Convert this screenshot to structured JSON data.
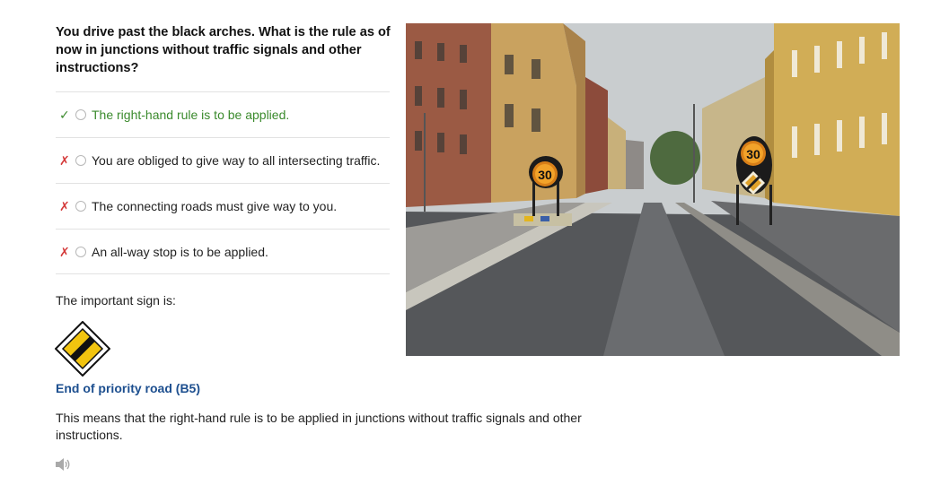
{
  "question": {
    "text": "You drive past the black arches. What is the rule as of now in junctions without traffic signals and other instructions?"
  },
  "answers": [
    {
      "mark": "✓",
      "label": "The right-hand rule is to be applied.",
      "status": "correct"
    },
    {
      "mark": "✗",
      "label": "You are obliged to give way to all intersecting traffic.",
      "status": "wrong"
    },
    {
      "mark": "✗",
      "label": "The connecting roads must give way to you.",
      "status": "wrong"
    },
    {
      "mark": "✗",
      "label": "An all-way stop is to be applied.",
      "status": "wrong"
    }
  ],
  "important_label": "The important sign is:",
  "sign": {
    "name": "End of priority road (B5)",
    "icon": "end-of-priority-road-sign-icon"
  },
  "explanation": "This means that the right-hand rule is to be applied in junctions without traffic signals and other instructions.",
  "audio": {
    "icon": "speaker-icon"
  },
  "photo": {
    "speed_sign_left": "30",
    "speed_sign_right": "30"
  },
  "colors": {
    "correct": "#3a8a2c",
    "wrong": "#d43a3a",
    "link": "#1d4f8f",
    "sign_yellow": "#f2c40f"
  }
}
